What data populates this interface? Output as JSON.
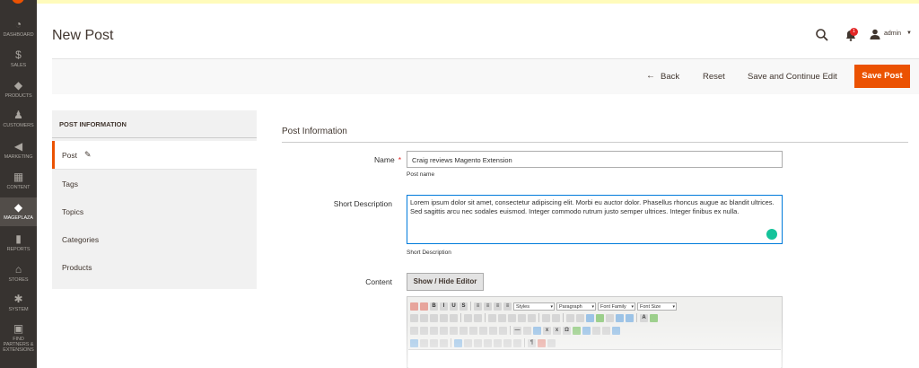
{
  "sidebar": {
    "items": [
      {
        "icon": "dashboard-icon",
        "label": "DASHBOARD",
        "glyph": "◔"
      },
      {
        "icon": "dollar-icon",
        "label": "SALES",
        "glyph": "$"
      },
      {
        "icon": "cube-icon",
        "label": "PRODUCTS",
        "glyph": "◆"
      },
      {
        "icon": "person-icon",
        "label": "CUSTOMERS",
        "glyph": "♟"
      },
      {
        "icon": "megaphone-icon",
        "label": "MARKETING",
        "glyph": "◀"
      },
      {
        "icon": "content-icon",
        "label": "CONTENT",
        "glyph": "▦"
      },
      {
        "icon": "mageplaza-icon",
        "label": "MAGEPLAZA",
        "glyph": "◆"
      },
      {
        "icon": "bar-chart-icon",
        "label": "REPORTS",
        "glyph": "▮"
      },
      {
        "icon": "store-icon",
        "label": "STORES",
        "glyph": "⌂"
      },
      {
        "icon": "gear-icon",
        "label": "SYSTEM",
        "glyph": "✱"
      },
      {
        "icon": "puzzle-icon",
        "label": "FIND PARTNERS & EXTENSIONS",
        "glyph": "▣"
      }
    ]
  },
  "header": {
    "title": "New Post",
    "notification_count": "1",
    "username": "admin"
  },
  "actions": {
    "back": "Back",
    "reset": "Reset",
    "save_continue": "Save and Continue Edit",
    "save_post": "Save Post"
  },
  "tabs_panel": {
    "heading": "POST INFORMATION",
    "tabs": [
      "Post",
      "Tags",
      "Topics",
      "Categories",
      "Products"
    ]
  },
  "form": {
    "section_title": "Post Information",
    "name_label": "Name",
    "name_value": "Craig reviews Magento Extension",
    "name_note": "Post name",
    "short_desc_label": "Short Description",
    "short_desc_value": "Lorem ipsum dolor sit amet, consectetur adipiscing elit. Morbi eu auctor dolor. Phasellus rhoncus augue ac blandit ultrices. Sed sagittis arcu nec sodales euismod. Integer commodo rutrum justo semper ultrices. Integer finibus ex nulla.",
    "short_desc_note": "Short Description",
    "content_label": "Content",
    "show_hide_editor": "Show / Hide Editor"
  },
  "editor": {
    "styles": "Styles",
    "paragraph": "Paragraph",
    "font_family": "Font Family",
    "font_size": "Font Size"
  },
  "colors": {
    "accent": "#eb5202",
    "sidebar_bg": "#373330",
    "notice_bg": "#fffbbb"
  }
}
